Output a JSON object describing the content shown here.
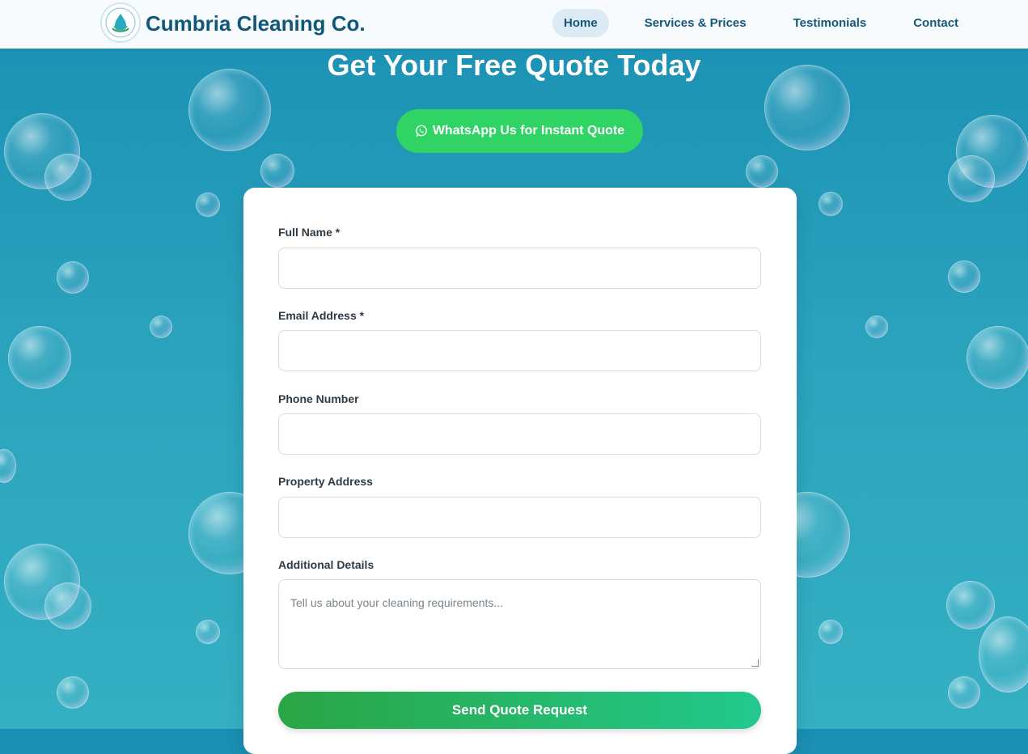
{
  "header": {
    "brand": "Cumbria Cleaning Co.",
    "logo_text": "CUMBRIA CLEANING CO.",
    "nav": [
      {
        "label": "Home",
        "active": true
      },
      {
        "label": "Services & Prices",
        "active": false
      },
      {
        "label": "Testimonials",
        "active": false
      },
      {
        "label": "Contact",
        "active": false
      }
    ]
  },
  "hero": {
    "title": "Get Your Free Quote Today",
    "whatsapp_label": "WhatsApp Us for Instant Quote"
  },
  "form": {
    "full_name_label": "Full Name *",
    "email_label": "Email Address *",
    "phone_label": "Phone Number",
    "address_label": "Property Address",
    "details_label": "Additional Details",
    "details_placeholder": "Tell us about your cleaning requirements...",
    "submit_label": "Send Quote Request"
  },
  "colors": {
    "brand": "#10587a",
    "whatsapp": "#2fd464",
    "submit_start": "#2aa544",
    "submit_end": "#22c98e",
    "background": "#1a8fb3"
  },
  "icons": [
    "logo-icon",
    "whatsapp-icon"
  ]
}
